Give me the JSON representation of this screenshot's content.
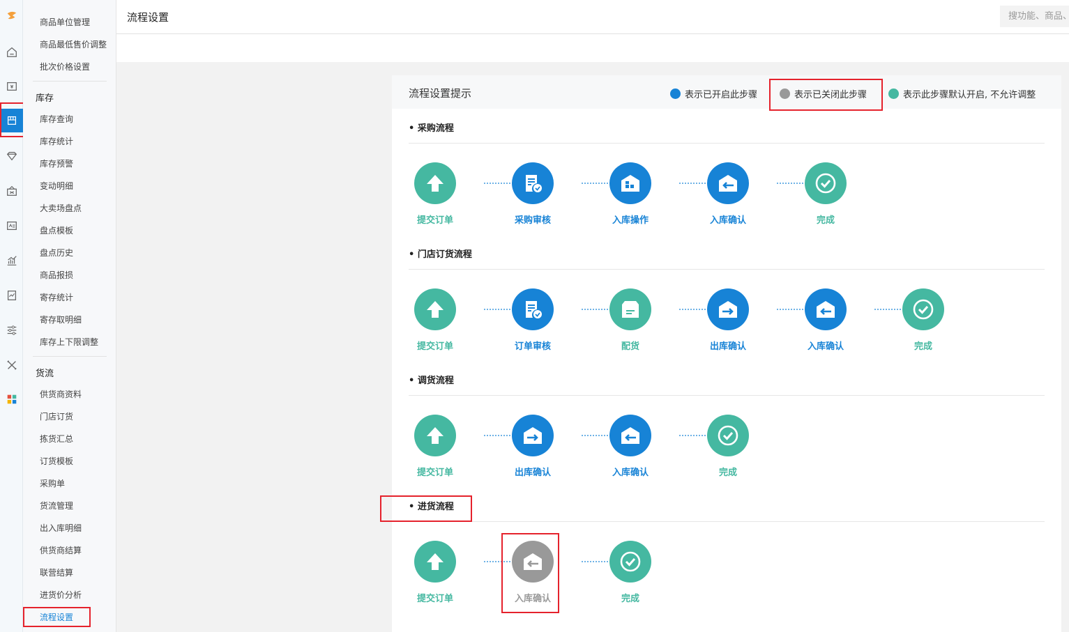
{
  "colors": {
    "open": "#1783d6",
    "closed": "#999999",
    "fixed": "#45b8a1",
    "highlight": "#e5222c",
    "logo": "#f4a03c"
  },
  "header": {
    "title": "流程设置",
    "search_placeholder": "搜功能、商品、"
  },
  "rail_icons": [
    "logo-icon",
    "home-icon",
    "finance-icon",
    "inventory-icon",
    "member-icon",
    "promotion-icon",
    "card-icon",
    "chart-icon",
    "report-icon",
    "settings-sliders-icon",
    "tools-icon",
    "apps-icon"
  ],
  "submenu": {
    "top_items": [
      "商品单位管理",
      "商品最低售价调整",
      "批次价格设置"
    ],
    "groups": [
      {
        "title": "库存",
        "items": [
          "库存查询",
          "库存统计",
          "库存预警",
          "变动明细",
          "大卖场盘点",
          "盘点模板",
          "盘点历史",
          "商品报损",
          "寄存统计",
          "寄存取明细",
          "库存上下限调整"
        ]
      },
      {
        "title": "货流",
        "items": [
          "供货商资料",
          "门店订货",
          "拣货汇总",
          "订货模板",
          "采购单",
          "货流管理",
          "出入库明细",
          "供货商结算",
          "联营结算",
          "进货价分析",
          "流程设置"
        ]
      }
    ]
  },
  "card": {
    "title": "流程设置提示",
    "legend": [
      {
        "label": "表示已开启此步骤",
        "color": "#1783d6"
      },
      {
        "label": "表示已关闭此步骤",
        "color": "#999999"
      },
      {
        "label": "表示此步骤默认开启, 不允许调整",
        "color": "#45b8a1"
      }
    ],
    "flows": [
      {
        "title": "• 采购流程",
        "steps": [
          {
            "label": "提交订单",
            "state": "fixed",
            "icon": "upload-icon"
          },
          {
            "label": "采购审核",
            "state": "open",
            "icon": "audit-icon"
          },
          {
            "label": "入库操作",
            "state": "open",
            "icon": "warehouse-icon"
          },
          {
            "label": "入库确认",
            "state": "open",
            "icon": "inbound-icon"
          },
          {
            "label": "完成",
            "state": "fixed",
            "icon": "check-icon"
          }
        ]
      },
      {
        "title": "• 门店订货流程",
        "steps": [
          {
            "label": "提交订单",
            "state": "fixed",
            "icon": "upload-icon"
          },
          {
            "label": "订单审核",
            "state": "open",
            "icon": "audit-icon"
          },
          {
            "label": "配货",
            "state": "fixed",
            "icon": "box-icon"
          },
          {
            "label": "出库确认",
            "state": "open",
            "icon": "outbound-icon"
          },
          {
            "label": "入库确认",
            "state": "open",
            "icon": "inbound-icon"
          },
          {
            "label": "完成",
            "state": "fixed",
            "icon": "check-icon"
          }
        ]
      },
      {
        "title": "• 调货流程",
        "steps": [
          {
            "label": "提交订单",
            "state": "fixed",
            "icon": "upload-icon"
          },
          {
            "label": "出库确认",
            "state": "open",
            "icon": "outbound-icon"
          },
          {
            "label": "入库确认",
            "state": "open",
            "icon": "inbound-icon"
          },
          {
            "label": "完成",
            "state": "fixed",
            "icon": "check-icon"
          }
        ]
      },
      {
        "title": "• 进货流程",
        "steps": [
          {
            "label": "提交订单",
            "state": "fixed",
            "icon": "upload-icon"
          },
          {
            "label": "入库确认",
            "state": "closed",
            "icon": "inbound-icon"
          },
          {
            "label": "完成",
            "state": "fixed",
            "icon": "check-icon"
          }
        ]
      }
    ]
  }
}
